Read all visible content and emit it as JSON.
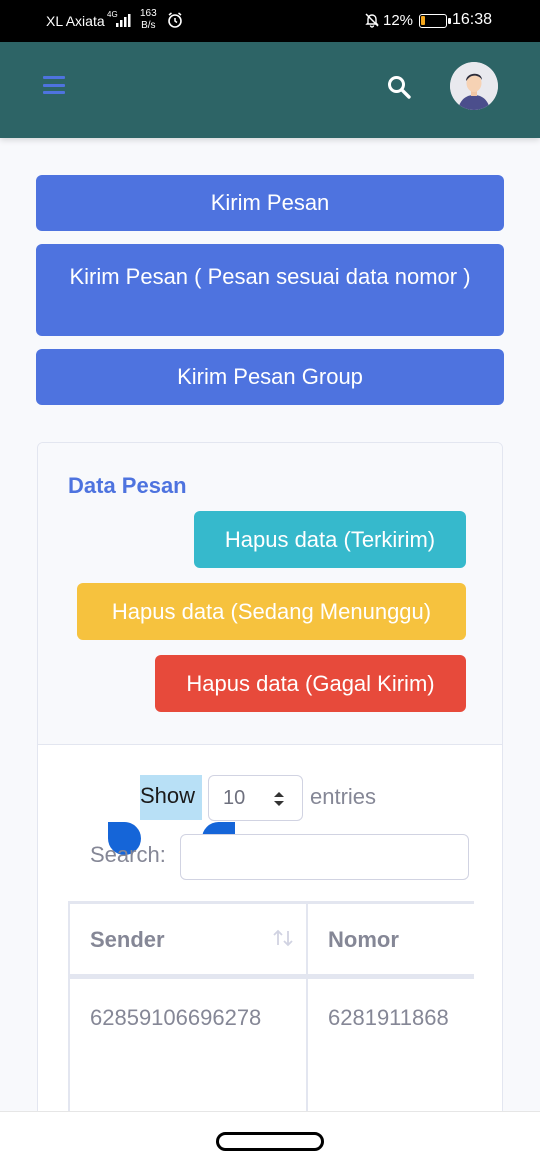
{
  "status_bar": {
    "carrier": "XL Axiata",
    "network": "4G",
    "speed_value": "163",
    "speed_unit": "B/s",
    "battery": "12%",
    "time": "16:38"
  },
  "topbar": {
    "color": "#2d6466",
    "icons": [
      "menu-icon",
      "search-icon",
      "avatar"
    ]
  },
  "actions": {
    "kirim_pesan": "Kirim Pesan",
    "kirim_pesan_nomor": "Kirim Pesan ( Pesan sesuai data nomor )",
    "kirim_pesan_group": "Kirim Pesan Group"
  },
  "card": {
    "title": "Data Pesan",
    "hapus_terkirim": "Hapus data (Terkirim)",
    "hapus_menunggu": "Hapus data (Sedang Menunggu)",
    "hapus_gagal": "Hapus data (Gagal Kirim)"
  },
  "datatable": {
    "show_label": "Show",
    "length_value": "10",
    "entries_label": "entries",
    "search_label": "Search:",
    "search_value": "",
    "columns": [
      "Sender",
      "Nomor"
    ],
    "rows": [
      [
        "62859106696278",
        "6281911868"
      ]
    ]
  },
  "colors": {
    "primary": "#4e73df",
    "info": "#36b9cc",
    "warning": "#f6c23e",
    "danger": "#e74a3b"
  }
}
